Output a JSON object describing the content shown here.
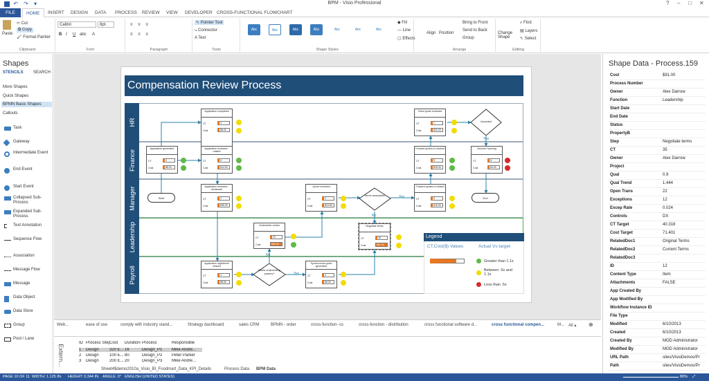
{
  "window": {
    "title": "BPM - Visio Professional",
    "quick_access": "↶ ↷ ▾"
  },
  "tabs": [
    "FILE",
    "HOME",
    "INSERT",
    "DESIGN",
    "DATA",
    "PROCESS",
    "REVIEW",
    "VIEW",
    "DEVELOPER",
    "CROSS-FUNCTIONAL FLOWCHART"
  ],
  "ribbon": {
    "clipboard": {
      "paste": "Paste",
      "cut": "Cut",
      "copy": "Copy",
      "format_painter": "Format Painter",
      "label": "Clipboard"
    },
    "font": {
      "family": "Calibri",
      "size": "8pt.",
      "label": "Font"
    },
    "paragraph": {
      "label": "Paragraph"
    },
    "tools": {
      "pointer": "Pointer Tool",
      "connector": "Connector",
      "text": "Text",
      "label": "Tools"
    },
    "shape_styles": {
      "swatch": "Abc",
      "label": "Shape Styles",
      "fill": "Fill",
      "line": "Line",
      "effects": "Effects"
    },
    "arrange": {
      "align": "Align",
      "position": "Position",
      "bring_front": "Bring to Front",
      "send_back": "Send to Back",
      "group": "Group",
      "label": "Arrange"
    },
    "editing": {
      "change_shape": "Change Shape",
      "find": "Find",
      "layers": "Layers",
      "select": "Select",
      "label": "Editing"
    }
  },
  "shapes_pane": {
    "title": "Shapes",
    "tabs": [
      "STENCILS",
      "SEARCH"
    ],
    "stencils": [
      "More Shapes",
      "Quick Shapes",
      "BPMN Basic Shapes",
      "Callouts"
    ],
    "items": [
      "Task",
      "Gateway",
      "Intermediate Event",
      "End Event",
      "Start Event",
      "Collapsed Sub-Process",
      "Expanded Sub-Process",
      "Text Annotation",
      "Sequence Flow",
      "Association",
      "Message Flow",
      "Message",
      "Data Object",
      "Data Store",
      "Group",
      "Pool / Lane"
    ]
  },
  "diagram": {
    "title": "Compensation Review Process",
    "lanes": [
      "HR",
      "Finance",
      "Manager",
      "Leadership",
      "Payroll"
    ],
    "boxes": [
      {
        "title": "Application completed",
        "ct": "4",
        "cost": "$8.00",
        "dots": [
          "y",
          "y"
        ]
      },
      {
        "title": "Application generated",
        "ct": "3",
        "cost": "$8.00",
        "dots": [
          "g",
          "g"
        ]
      },
      {
        "title": "Application reviewed - related",
        "ct": "5",
        "cost": "$14.00",
        "dots": [
          "g",
          "g"
        ]
      },
      {
        "title": "Application reviewed - wholesale",
        "ct": "2",
        "cost": "$35.00",
        "dots": [
          "y",
          "y"
        ]
      },
      {
        "title": "Quote reviewed",
        "ct": "4",
        "cost": "$13.50",
        "dots": [
          "y",
          "y"
        ]
      },
      {
        "title": "Client quote reviewed",
        "ct": "7",
        "cost": "$22.00",
        "dots": [
          "y",
          "y"
        ]
      },
      {
        "title": "Forward quotes to insured",
        "ct": "5",
        "cost": "$18.00",
        "dots": [
          "g",
          "g"
        ]
      },
      {
        "title": "Account Opening",
        "ct": "8",
        "cost": "$4.00",
        "dots": [
          "r",
          "r"
        ]
      },
      {
        "title": "Forward quotes to related",
        "ct": "6",
        "cost": "$16.00",
        "dots": [
          "y",
          "y"
        ]
      },
      {
        "title": "Underwriter review",
        "ct": "22",
        "cost": "$90.00",
        "dots": [
          "y",
          "g"
        ]
      },
      {
        "title": "Negotiate terms",
        "ct": "35",
        "cost": "$91.00",
        "dots": [
          "y",
          "y"
        ]
      },
      {
        "title": "Application registered/ cleared",
        "ct": "4",
        "cost": "$8.50",
        "dots": [
          "y",
          "y"
        ]
      },
      {
        "title": "Synchronous quote generated",
        "ct": "4",
        "cost": "$8.00",
        "dots": [
          "y",
          "y"
        ]
      }
    ],
    "events": {
      "start": "Start",
      "end": "End"
    },
    "gateways": {
      "accepted": "Accepted",
      "terms": "Terms acceptable",
      "meets": "Meets underwriting params?"
    },
    "flow_labels": {
      "yes": "Yes",
      "no": "No"
    },
    "legend": {
      "title": "Legend",
      "col1": "CT,Cost($) Values",
      "col2": "Actual Vs target",
      "rows": [
        "Greater than 1.1x",
        "Between .5x and 1.1x",
        "Less than .5x"
      ]
    }
  },
  "shape_data": {
    "title": "Shape Data - Process.159",
    "rows": [
      [
        "Cost",
        "$91.00"
      ],
      [
        "Process Number",
        ""
      ],
      [
        "Owner",
        "Alex Darrow"
      ],
      [
        "Function",
        "Leadership"
      ],
      [
        "Start Date",
        ""
      ],
      [
        "End Date",
        ""
      ],
      [
        "Status",
        ""
      ],
      [
        "PropertyB",
        ""
      ],
      [
        "Step",
        "Negotiate terms"
      ],
      [
        "CT",
        "35"
      ],
      [
        "Owner",
        "Alex Darrow"
      ],
      [
        "Project",
        ""
      ],
      [
        "Qual",
        "0.9"
      ],
      [
        "Qual Trend",
        "1.444"
      ],
      [
        "Open Trans",
        "22"
      ],
      [
        "Exceptions",
        "12"
      ],
      [
        "Excep Rate",
        "0.024"
      ],
      [
        "Controls",
        "DX"
      ],
      [
        "CT Target",
        "40.318"
      ],
      [
        "Cost Target",
        "71.401"
      ],
      [
        "RelatedDoc1",
        "Original Terms"
      ],
      [
        "RelatedDoc2",
        "Current Terms"
      ],
      [
        "RelatedDoc3",
        ""
      ],
      [
        "ID",
        "12"
      ],
      [
        "Content Type",
        "Item"
      ],
      [
        "Attachments",
        "FALSE"
      ],
      [
        "App Created By",
        ""
      ],
      [
        "App Modified By",
        ""
      ],
      [
        "Workflow Instance ID",
        ""
      ],
      [
        "File Type",
        ""
      ],
      [
        "Modified",
        "6/10/2013"
      ],
      [
        "Created",
        "6/10/2013"
      ],
      [
        "Created By",
        "MOD Administrator"
      ],
      [
        "Modified By",
        "MOD Administrator"
      ],
      [
        "URL Path",
        "sites/VisioDemos/Pr"
      ],
      [
        "Path",
        "sites/VisioDemos/Pr"
      ],
      [
        "Item Type",
        ""
      ]
    ]
  },
  "page_tabs": [
    "Web...",
    "ease of use",
    "comply with industry stand...",
    "Strategy dashboard",
    "sales CRM",
    "BPMN - order",
    "cross-function- cs",
    "cross-function - distribution",
    "cross functional software d...",
    "cross functional compen...",
    "M...",
    "All ▴"
  ],
  "external_data": {
    "label": "Extern...",
    "headers": [
      "ID",
      "Process Step",
      "Cost",
      "Duration",
      "Process",
      "Responsible"
    ],
    "rows": [
      [
        "1",
        "Design",
        "320 E...",
        "16",
        "Design_P1",
        "Mike Andre..."
      ],
      [
        "2",
        "Design",
        "100 E...",
        "80",
        "Design_P2",
        "Peter Parker"
      ],
      [
        "3",
        "Design",
        "200 E...",
        "20",
        "Design_P3",
        "Mike Andre..."
      ]
    ],
    "tabs": [
      "Sheet4$demo2010a_Visio_BI_Foodmart_Data_KPI_Details",
      "Process Data",
      "BPM Data"
    ]
  },
  "status": {
    "page": "PAGE 10 OF 11",
    "width": "WIDTH: 1.125 IN.",
    "height": "HEIGHT: 0.344 IN.",
    "angle": "ANGLE: 0°",
    "lang": "ENGLISH (UNITED STATES)",
    "zoom": "80%"
  }
}
